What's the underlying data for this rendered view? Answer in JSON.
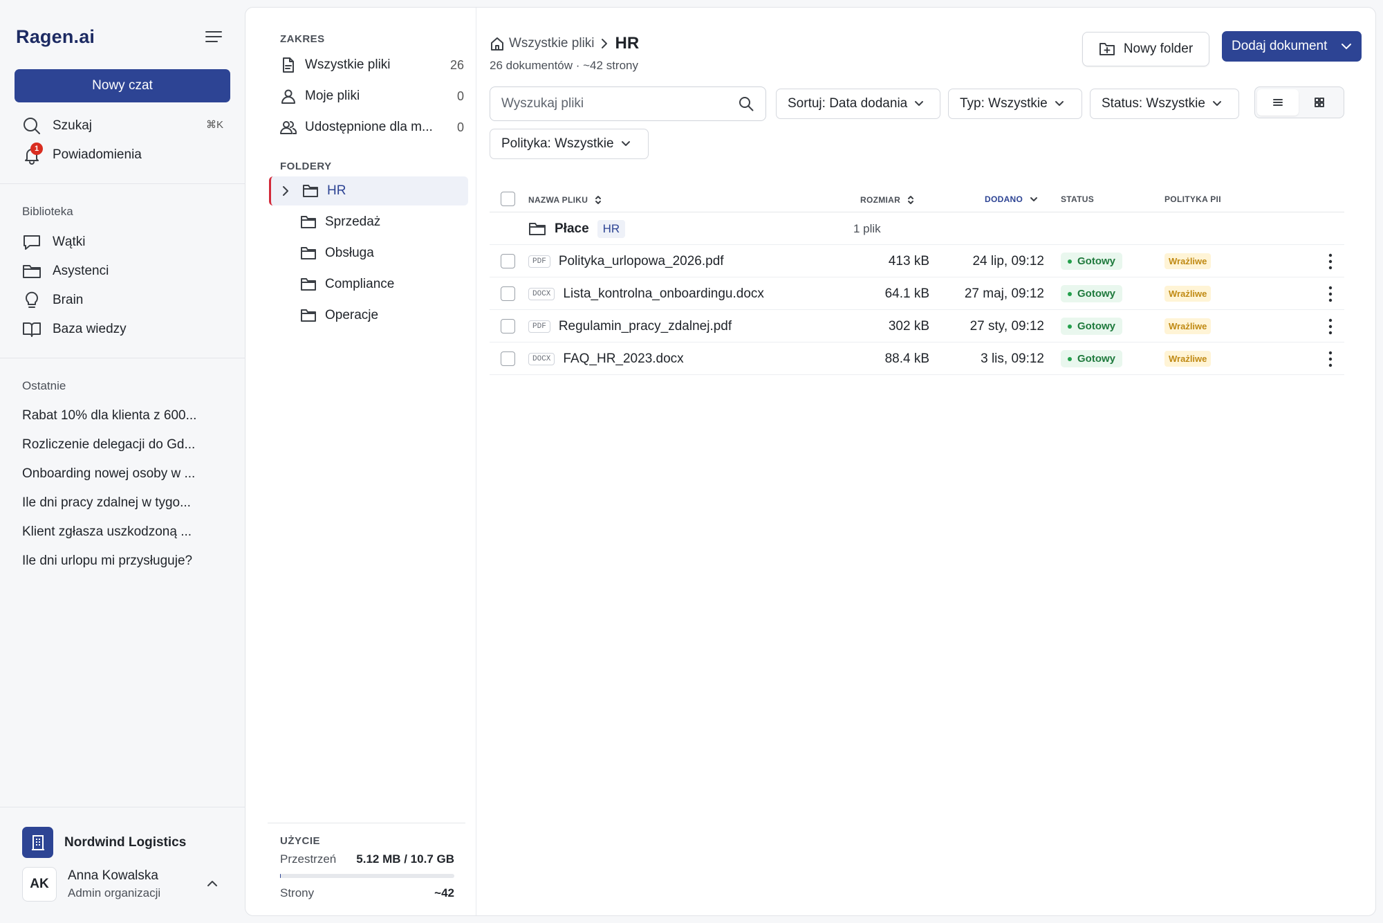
{
  "app": {
    "logo": "Ragen.ai"
  },
  "sidebar": {
    "new_chat": "Nowy czat",
    "search_label": "Szukaj",
    "search_shortcut": "⌘K",
    "notifications_label": "Powiadomienia",
    "notifications_count": "1",
    "library_title": "Biblioteka",
    "library_items": [
      {
        "label": "Wątki",
        "icon": "chat-bubble-icon"
      },
      {
        "label": "Asystenci",
        "icon": "folder-icon"
      },
      {
        "label": "Brain",
        "icon": "lightbulb-icon"
      },
      {
        "label": "Baza wiedzy",
        "icon": "book-icon"
      }
    ],
    "recent_title": "Ostatnie",
    "recent": [
      "Rabat 10% dla klienta z 600...",
      "Rozliczenie delegacji do Gd...",
      "Onboarding nowej osoby w ...",
      "Ile dni pracy zdalnej w tygo...",
      "Klient zgłasza uszkodzoną ...",
      "Ile dni urlopu mi przysługuje?"
    ],
    "org_name": "Nordwind Logistics",
    "user": {
      "initials": "AK",
      "name": "Anna Kowalska",
      "role": "Admin organizacji"
    }
  },
  "folders_panel": {
    "scope_title": "ZAKRES",
    "scope": [
      {
        "label": "Wszystkie pliki",
        "count": "26"
      },
      {
        "label": "Moje pliki",
        "count": "0"
      },
      {
        "label": "Udostępnione dla m...",
        "count": "0"
      }
    ],
    "folders_title": "FOLDERY",
    "folders": [
      "HR",
      "Sprzedaż",
      "Obsługa",
      "Compliance",
      "Operacje"
    ],
    "usage_title": "UŻYCIE",
    "space_label": "Przestrzeń",
    "space_value": "5.12 MB / 10.7 GB",
    "space_fraction": 0.0005,
    "pages_label": "Strony",
    "pages_value": "~42"
  },
  "content": {
    "breadcrumb_root": "Wszystkie pliki",
    "breadcrumb_current": "HR",
    "subtitle": "26 dokumentów · ~42 strony",
    "new_folder": "Nowy folder",
    "add_document": "Dodaj dokument",
    "search_placeholder": "Wyszukaj pliki",
    "filters": {
      "sort": "Sortuj: Data dodania",
      "type": "Typ: Wszystkie",
      "status": "Status: Wszystkie",
      "policy": "Polityka: Wszystkie"
    },
    "columns": {
      "name": "NAZWA PLIKU",
      "size": "ROZMIAR",
      "added": "DODANO",
      "status": "STATUS",
      "policy": "POLITYKA PII"
    },
    "folder_row": {
      "name": "Płace",
      "tag": "HR",
      "count": "1 plik"
    },
    "files": [
      {
        "type": "PDF",
        "name": "Polityka_urlopowa_2026.pdf",
        "size": "413 kB",
        "added": "24 lip, 09:12",
        "status": "Gotowy",
        "pii": "Wrażliwe"
      },
      {
        "type": "DOCX",
        "name": "Lista_kontrolna_onboardingu.docx",
        "size": "64.1 kB",
        "added": "27 maj, 09:12",
        "status": "Gotowy",
        "pii": "Wrażliwe"
      },
      {
        "type": "PDF",
        "name": "Regulamin_pracy_zdalnej.pdf",
        "size": "302 kB",
        "added": "27 sty, 09:12",
        "status": "Gotowy",
        "pii": "Wrażliwe"
      },
      {
        "type": "DOCX",
        "name": "FAQ_HR_2023.docx",
        "size": "88.4 kB",
        "added": "3 lis, 09:12",
        "status": "Gotowy",
        "pii": "Wrażliwe"
      }
    ]
  },
  "colors": {
    "primary": "#2d4494",
    "accent_red": "#d22a3a",
    "ready_green": "#1f7a3d",
    "pii_amber": "#c08a14"
  }
}
